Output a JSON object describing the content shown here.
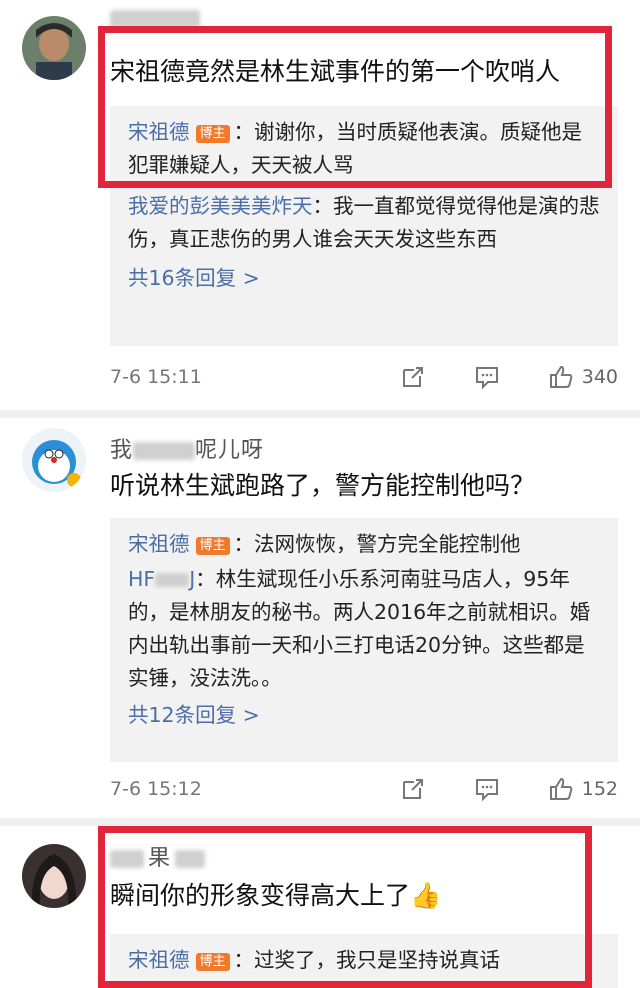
{
  "comments": [
    {
      "author_suffix": "",
      "text": "宋祖德竟然是林生斌事件的第一个吹哨人",
      "replies": [
        {
          "user": "宋祖德",
          "badge": "博主",
          "text": "：谢谢你，当时质疑他表演。质疑他是犯罪嫌疑人，天天被人骂"
        },
        {
          "user": "我爱的彭美美美炸天",
          "badge": "",
          "text": "：我一直都觉得觉得他是演的悲伤，真正悲伤的男人谁会天天发这些东西"
        }
      ],
      "more": "共16条回复 >",
      "time": "7-6 15:11",
      "likes": "340"
    },
    {
      "author_prefix": "我",
      "author_suffix": "呢儿呀",
      "text": "听说林生斌跑路了，警方能控制他吗？",
      "replies": [
        {
          "user": "宋祖德",
          "badge": "博主",
          "text": "：法网恢恢，警方完全能控制他"
        },
        {
          "user": "HF",
          "user_suffix": "J",
          "badge": "",
          "text": "：林生斌现任小乐系河南驻马店人，95年的，是林朋友的秘书。两人2016年之前就相识。婚内出轨出事前一天和小三打电话20分钟。这些都是实锤，没法洗。。"
        }
      ],
      "more": "共12条回复 >",
      "time": "7-6 15:12",
      "likes": "152"
    },
    {
      "author_mid": "果",
      "text": "瞬间你的形象变得高大上了👍",
      "replies": [
        {
          "user": "宋祖德",
          "badge": "博主",
          "text": "：过奖了，我只是坚持说真话"
        }
      ]
    }
  ],
  "colors": {
    "highlight": "#e1263b",
    "username": "#4b6ea8",
    "badge": "#f07a2a"
  },
  "icons": [
    "repost-icon",
    "comment-icon",
    "like-icon"
  ]
}
